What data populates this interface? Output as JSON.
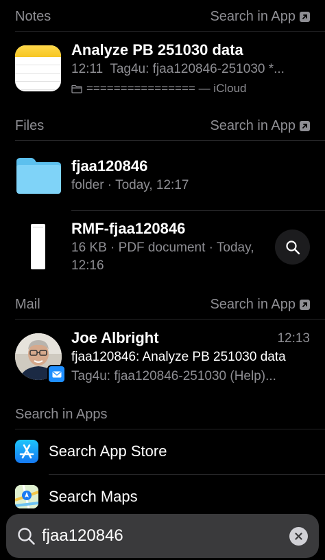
{
  "notes": {
    "header": "Notes",
    "search_in_app": "Search in App",
    "item": {
      "title": "Analyze PB 251030 data",
      "time": "12:11",
      "preview": "Tag4u: fjaa120846-251030 *...",
      "folder": "================ — iCloud"
    }
  },
  "files": {
    "header": "Files",
    "search_in_app": "Search in App",
    "items": [
      {
        "title": "fjaa120846",
        "subtitle": "folder · Today, 12:17"
      },
      {
        "title": "RMF-fjaa120846",
        "subtitle_line1": "16 KB · PDF document · Today,",
        "subtitle_line2": "12:16"
      }
    ]
  },
  "mail": {
    "header": "Mail",
    "search_in_app": "Search in App",
    "item": {
      "sender": "Joe Albright",
      "time": "12:13",
      "subject": "fjaa120846: Analyze PB 251030 data",
      "preview": "Tag4u: fjaa120846-251030 (Help)..."
    }
  },
  "search_in_apps": {
    "header": "Search in Apps",
    "items": [
      {
        "label": "Search App Store",
        "icon": "app-store-icon"
      },
      {
        "label": "Search Maps",
        "icon": "maps-icon"
      }
    ]
  },
  "search": {
    "query": "fjaa120846"
  },
  "colors": {
    "background": "#000000",
    "secondary_text": "#8e8e93",
    "search_bar": "#3a3a3c",
    "mail_badge": "#1f8fff",
    "folder": "#6ccdf6"
  }
}
